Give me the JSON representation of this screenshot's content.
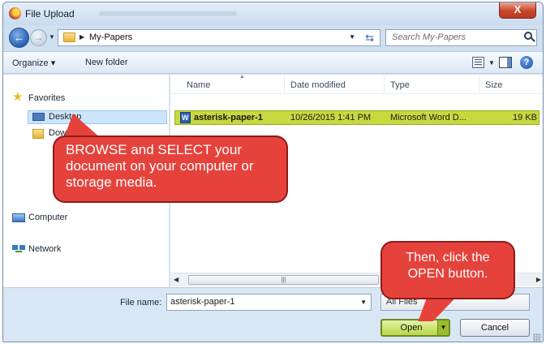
{
  "window": {
    "title": "File Upload",
    "close_label": "X"
  },
  "address": {
    "crumb": "My-Papers"
  },
  "search": {
    "placeholder": "Search My-Papers"
  },
  "toolbar": {
    "organize": "Organize ▾",
    "new_folder": "New folder"
  },
  "sidebar": {
    "favorites": "Favorites",
    "desktop": "Desktop",
    "downloads": "Downloads",
    "computer": "Computer",
    "network": "Network"
  },
  "columns": {
    "name": "Name",
    "date": "Date modified",
    "type": "Type",
    "size": "Size"
  },
  "files": [
    {
      "name": "asterisk-paper-1",
      "date": "10/26/2015 1:41 PM",
      "type": "Microsoft Word D...",
      "size": "19 KB"
    }
  ],
  "bottom": {
    "file_name_label": "File name:",
    "file_name_value": "asterisk-paper-1",
    "filter": "All Files",
    "open_label": "Open",
    "cancel_label": "Cancel"
  },
  "callouts": {
    "browse_text": "BROWSE and SELECT your document on your computer or storage media.",
    "open_text": "Then, click the OPEN button."
  },
  "colors": {
    "accent_green": "#c7d93f",
    "callout_red": "#e6423c",
    "window_blue": "#cfe0f1"
  }
}
